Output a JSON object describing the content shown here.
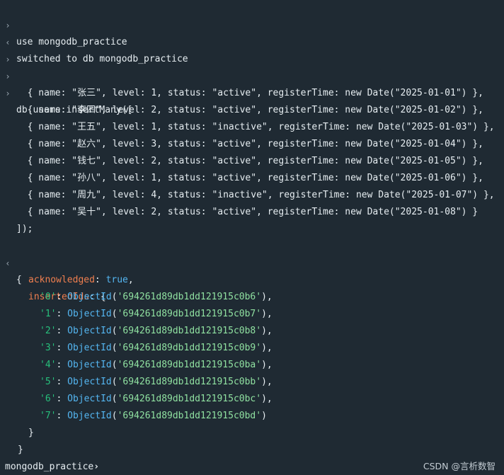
{
  "session": [
    {
      "gutter": "›",
      "text": "use mongodb_practice"
    },
    {
      "gutter": "‹",
      "text": "switched to db mongodb_practice"
    },
    {
      "gutter": "›",
      "text": ""
    },
    {
      "gutter": "›",
      "text": ""
    },
    {
      "gutter": "›",
      "text": "db.users.insertMany(["
    }
  ],
  "docs": [
    "  { name: \"张三\", level: 1, status: \"active\", registerTime: new Date(\"2025-01-01\") },",
    "  { name: \"李四\", level: 2, status: \"active\", registerTime: new Date(\"2025-01-02\") },",
    "  { name: \"王五\", level: 1, status: \"inactive\", registerTime: new Date(\"2025-01-03\") },",
    "  { name: \"赵六\", level: 3, status: \"active\", registerTime: new Date(\"2025-01-04\") },",
    "  { name: \"钱七\", level: 2, status: \"active\", registerTime: new Date(\"2025-01-05\") },",
    "  { name: \"孙八\", level: 1, status: \"active\", registerTime: new Date(\"2025-01-06\") },",
    "  { name: \"周九\", level: 4, status: \"inactive\", registerTime: new Date(\"2025-01-07\") },",
    "  { name: \"吴十\", level: 2, status: \"active\", registerTime: new Date(\"2025-01-08\") }"
  ],
  "close_call": "]);",
  "result": {
    "gutter": "‹",
    "open_brace": "{",
    "acknowledged_key": "acknowledged",
    "acknowledged_value": "true",
    "inserted_key": "insertedIds",
    "ids": [
      {
        "key": "'0'",
        "value": "'694261d89db1dd121915c0b6'"
      },
      {
        "key": "'1'",
        "value": "'694261d89db1dd121915c0b7'"
      },
      {
        "key": "'2'",
        "value": "'694261d89db1dd121915c0b8'"
      },
      {
        "key": "'3'",
        "value": "'694261d89db1dd121915c0b9'"
      },
      {
        "key": "'4'",
        "value": "'694261d89db1dd121915c0ba'"
      },
      {
        "key": "'5'",
        "value": "'694261d89db1dd121915c0bb'"
      },
      {
        "key": "'6'",
        "value": "'694261d89db1dd121915c0bc'"
      },
      {
        "key": "'7'",
        "value": "'694261d89db1dd121915c0bd'"
      }
    ],
    "fn_name": "ObjectId",
    "inner_close": "}",
    "outer_close": "}"
  },
  "prompt": {
    "db": "mongodb_practice",
    "arrow": "›"
  },
  "watermark": "CSDN @言析数智",
  "colors": {
    "background": "#1f2a33",
    "text": "#e6edf1",
    "key": "#f07f4f",
    "boolean": "#54b6f1",
    "id_key": "#27c07c",
    "function": "#54b6f1",
    "string": "#8fe0a0"
  }
}
